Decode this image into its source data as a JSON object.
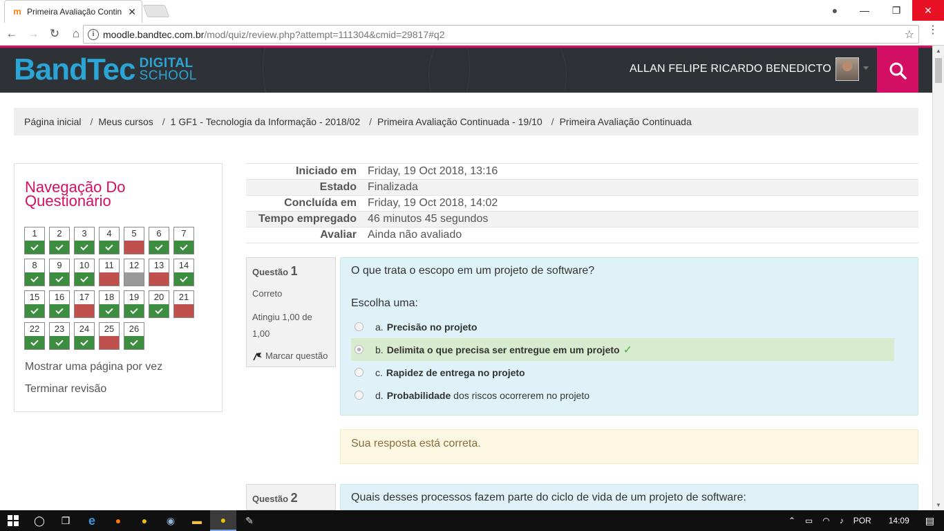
{
  "browser": {
    "tab_title": "Primeira Avaliação Contin",
    "url_host": "moodle.bandtec.com.br",
    "url_path": "/mod/quiz/review.php?attempt=111304&cmid=29817#q2"
  },
  "header": {
    "logo_main": "BandTec",
    "logo_sub_top": "DIGITAL",
    "logo_sub_bottom": "SCHOOL",
    "user_name": "ALLAN FELIPE RICARDO BENEDICTO",
    "accent_color": "#d20f64",
    "logo_color": "#2aa5d6"
  },
  "breadcrumb": [
    "Página inicial",
    "Meus cursos",
    "1 GF1 - Tecnologia da Informação - 2018/02",
    "Primeira Avaliação Continuada - 19/10",
    "Primeira Avaliação Continuada"
  ],
  "quiz_nav": {
    "title": "Navegação Do Questionário",
    "questions": [
      {
        "n": "1",
        "state": "correct"
      },
      {
        "n": "2",
        "state": "correct"
      },
      {
        "n": "3",
        "state": "correct"
      },
      {
        "n": "4",
        "state": "correct"
      },
      {
        "n": "5",
        "state": "incorrect"
      },
      {
        "n": "6",
        "state": "correct"
      },
      {
        "n": "7",
        "state": "correct"
      },
      {
        "n": "8",
        "state": "correct"
      },
      {
        "n": "9",
        "state": "correct"
      },
      {
        "n": "10",
        "state": "correct"
      },
      {
        "n": "11",
        "state": "incorrect"
      },
      {
        "n": "12",
        "state": "gray"
      },
      {
        "n": "13",
        "state": "incorrect"
      },
      {
        "n": "14",
        "state": "correct"
      },
      {
        "n": "15",
        "state": "correct"
      },
      {
        "n": "16",
        "state": "correct"
      },
      {
        "n": "17",
        "state": "incorrect"
      },
      {
        "n": "18",
        "state": "correct"
      },
      {
        "n": "19",
        "state": "correct"
      },
      {
        "n": "20",
        "state": "correct"
      },
      {
        "n": "21",
        "state": "incorrect"
      },
      {
        "n": "22",
        "state": "correct"
      },
      {
        "n": "23",
        "state": "correct"
      },
      {
        "n": "24",
        "state": "correct"
      },
      {
        "n": "25",
        "state": "incorrect"
      },
      {
        "n": "26",
        "state": "correct"
      }
    ],
    "show_one_page": "Mostrar uma página por vez",
    "finish_review": "Terminar revisão"
  },
  "summary": [
    {
      "label": "Iniciado em",
      "value": "Friday, 19 Oct 2018, 13:16"
    },
    {
      "label": "Estado",
      "value": "Finalizada"
    },
    {
      "label": "Concluída em",
      "value": "Friday, 19 Oct 2018, 14:02"
    },
    {
      "label": "Tempo empregado",
      "value": "46 minutos 45 segundos"
    },
    {
      "label": "Avaliar",
      "value": "Ainda não avaliado"
    }
  ],
  "question1": {
    "label": "Questão",
    "number": "1",
    "status": "Correto",
    "grade": "Atingiu 1,00 de 1,00",
    "flag": "Marcar questão",
    "text": "O que trata o escopo em um projeto de software?",
    "prompt": "Escolha uma:",
    "answers": [
      {
        "letter": "a.",
        "bold": "Precisão no projeto",
        "rest": ""
      },
      {
        "letter": "b.",
        "bold": "Delimita o que precisa ser entregue em um projeto",
        "rest": ""
      },
      {
        "letter": "c.",
        "bold": "Rapidez de entrega no projeto",
        "rest": ""
      },
      {
        "letter": "d.",
        "bold": "Probabilidade",
        "rest": " dos riscos ocorrerem no projeto"
      }
    ],
    "feedback": "Sua resposta está correta."
  },
  "question2": {
    "label": "Questão",
    "number": "2",
    "text": "Quais desses processos fazem parte do ciclo de vida de um projeto de software:"
  },
  "taskbar": {
    "lang": "POR",
    "time": "14:09"
  }
}
